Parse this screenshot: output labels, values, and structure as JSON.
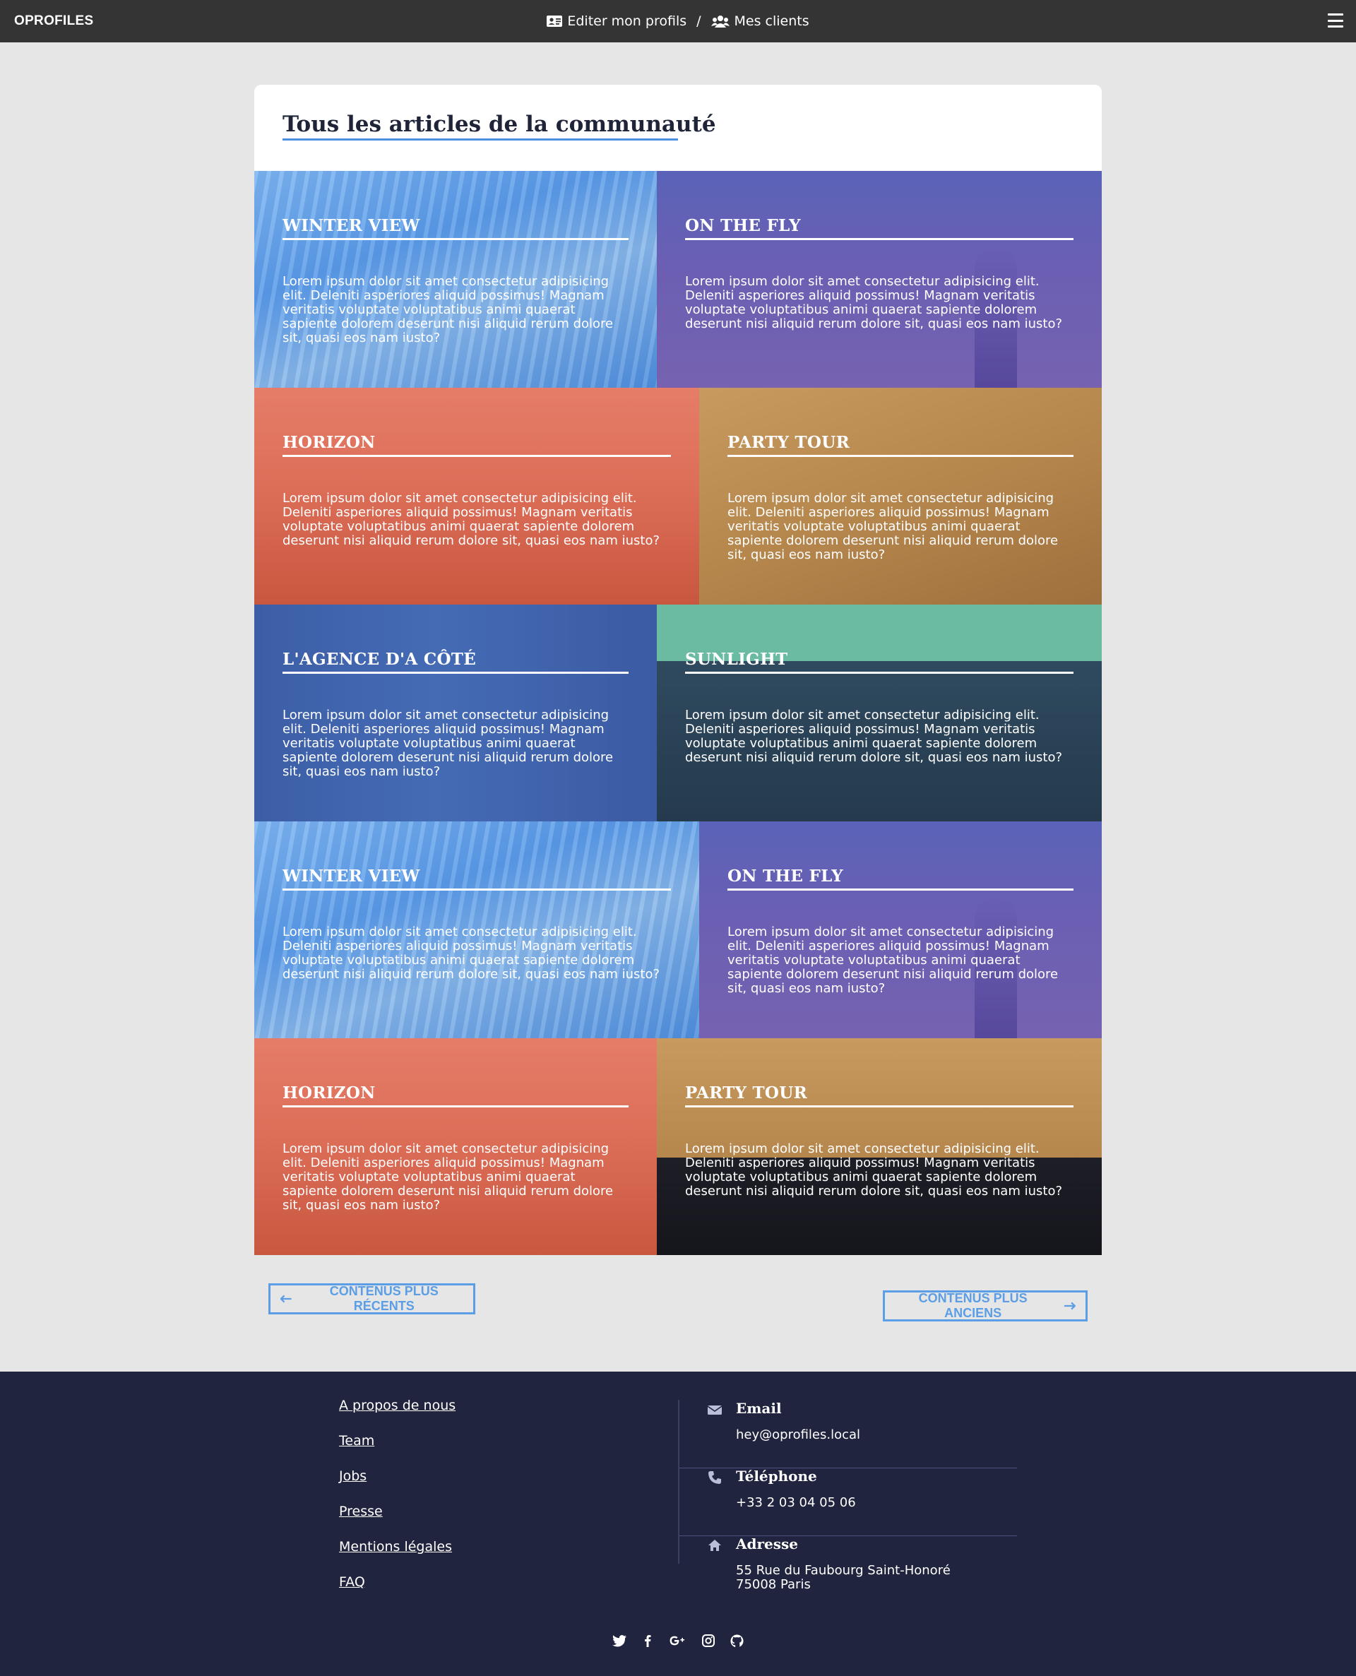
{
  "nav": {
    "brand": "OPROFILES",
    "link_profile": "Editer mon profils",
    "separator": "/",
    "link_clients": "Mes clients",
    "menu_icon": "hamburger-icon"
  },
  "page": {
    "title": "Tous les articles de la communauté"
  },
  "articles": [
    {
      "title": "WINTER VIEW",
      "text": "Lorem ipsum dolor sit amet consectetur adipisicing elit. Deleniti asperiores aliquid possimus! Magnam veritatis voluptate voluptatibus animi quaerat sapiente dolorem deserunt nisi aliquid rerum dolore sit, quasi eos nam iusto?"
    },
    {
      "title": "ON THE FLY",
      "text": "Lorem ipsum dolor sit amet consectetur adipisicing elit. Deleniti asperiores aliquid possimus! Magnam veritatis voluptate voluptatibus animi quaerat sapiente dolorem deserunt nisi aliquid rerum dolore sit, quasi eos nam iusto?"
    },
    {
      "title": "HORIZON",
      "text": "Lorem ipsum dolor sit amet consectetur adipisicing elit. Deleniti asperiores aliquid possimus! Magnam veritatis voluptate voluptatibus animi quaerat sapiente dolorem deserunt nisi aliquid rerum dolore sit, quasi eos nam iusto?"
    },
    {
      "title": "PARTY TOUR",
      "text": "Lorem ipsum dolor sit amet consectetur adipisicing elit. Deleniti asperiores aliquid possimus! Magnam veritatis voluptate voluptatibus animi quaerat sapiente dolorem deserunt nisi aliquid rerum dolore sit, quasi eos nam iusto?"
    },
    {
      "title": "L'AGENCE D'A CÔTÉ",
      "text": "Lorem ipsum dolor sit amet consectetur adipisicing elit. Deleniti asperiores aliquid possimus! Magnam veritatis voluptate voluptatibus animi quaerat sapiente dolorem deserunt nisi aliquid rerum dolore sit, quasi eos nam iusto?"
    },
    {
      "title": "SUNLIGHT",
      "text": "Lorem ipsum dolor sit amet consectetur adipisicing elit. Deleniti asperiores aliquid possimus! Magnam veritatis voluptate voluptatibus animi quaerat sapiente dolorem deserunt nisi aliquid rerum dolore sit, quasi eos nam iusto?"
    },
    {
      "title": "WINTER VIEW",
      "text": "Lorem ipsum dolor sit amet consectetur adipisicing elit. Deleniti asperiores aliquid possimus! Magnam veritatis voluptate voluptatibus animi quaerat sapiente dolorem deserunt nisi aliquid rerum dolore sit, quasi eos nam iusto?"
    },
    {
      "title": "ON THE FLY",
      "text": "Lorem ipsum dolor sit amet consectetur adipisicing elit. Deleniti asperiores aliquid possimus! Magnam veritatis voluptate voluptatibus animi quaerat sapiente dolorem deserunt nisi aliquid rerum dolore sit, quasi eos nam iusto?"
    },
    {
      "title": "HORIZON",
      "text": "Lorem ipsum dolor sit amet consectetur adipisicing elit. Deleniti asperiores aliquid possimus! Magnam veritatis voluptate voluptatibus animi quaerat sapiente dolorem deserunt nisi aliquid rerum dolore sit, quasi eos nam iusto?"
    },
    {
      "title": "PARTY TOUR",
      "text": "Lorem ipsum dolor sit amet consectetur adipisicing elit. Deleniti asperiores aliquid possimus! Magnam veritatis voluptate voluptatibus animi quaerat sapiente dolorem deserunt nisi aliquid rerum dolore sit, quasi eos nam iusto?"
    }
  ],
  "pager": {
    "prev_label": "CONTENUS PLUS RÉCENTS",
    "next_label": "CONTENUS PLUS ANCIENS"
  },
  "footer": {
    "links": [
      "A propos de nous",
      "Team",
      "Jobs",
      "Presse",
      "Mentions légales",
      "FAQ"
    ],
    "email_label": "Email",
    "email_value": "hey@oprofiles.local",
    "phone_label": "Téléphone",
    "phone_value": "+33 2 03 04 05 06",
    "address_label": "Adresse",
    "address_line1": "55 Rue du Faubourg Saint-Honoré",
    "address_line2": "75008 Paris",
    "social": [
      "twitter-icon",
      "facebook-icon",
      "google-plus-icon",
      "instagram-icon",
      "github-icon"
    ]
  },
  "colors": {
    "navbar": "#343434",
    "accent": "#5b9ee6",
    "footer": "#21243e",
    "page_bg": "#e6e6e6"
  }
}
